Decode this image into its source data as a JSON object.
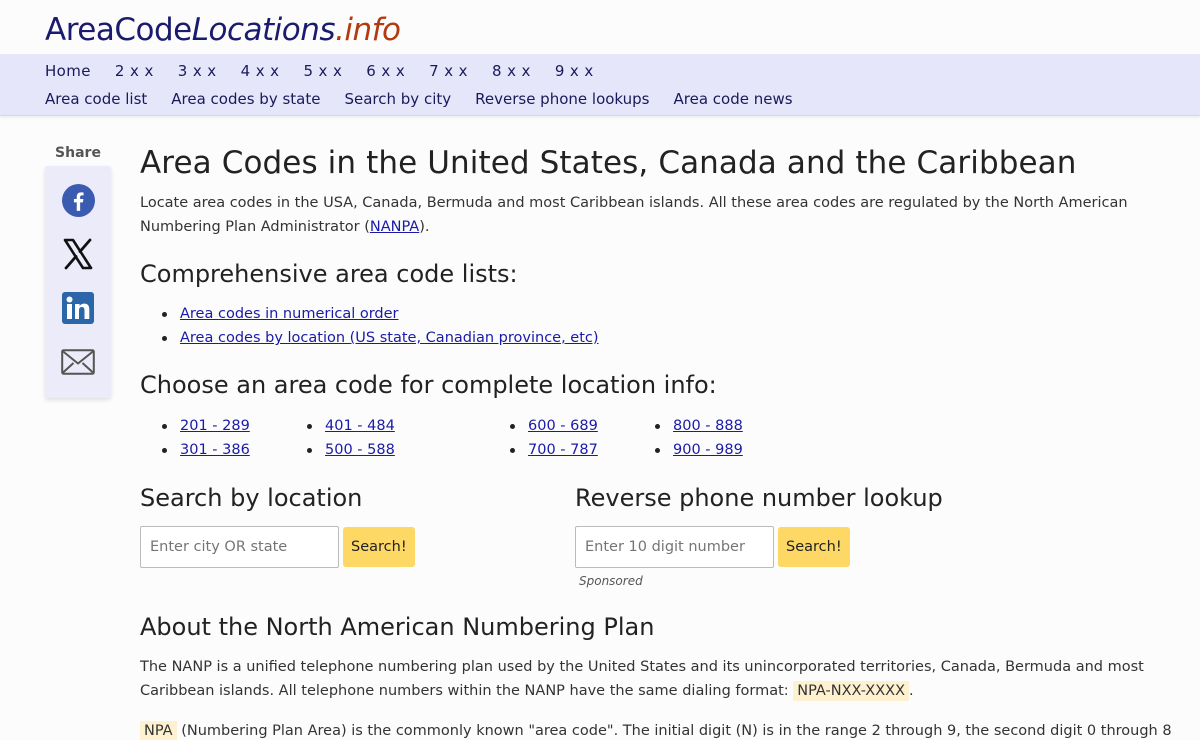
{
  "logo": {
    "part1": "AreaCode",
    "part2": "Locations",
    "part3": ".info"
  },
  "nav": {
    "row1": [
      "Home",
      "2 x x",
      "3 x x",
      "4 x x",
      "5 x x",
      "6 x x",
      "7 x x",
      "8 x x",
      "9 x x"
    ],
    "row2": [
      "Area code list",
      "Area codes by state",
      "Search by city",
      "Reverse phone lookups",
      "Area code news"
    ]
  },
  "share": {
    "label": "Share",
    "icons": [
      "facebook-icon",
      "x-icon",
      "linkedin-icon",
      "email-icon"
    ]
  },
  "main": {
    "title": "Area Codes in the United States, Canada and the Caribbean",
    "intro_before": "Locate area codes in the USA, Canada, Bermuda and most Caribbean islands. All these area codes are regulated by the North American Numbering Plan Administrator (",
    "intro_link": "NANPA",
    "intro_after": ").",
    "lists_heading": "Comprehensive area code lists:",
    "lists": [
      "Area codes in numerical order",
      "Area codes by location (US state, Canadian province, etc)"
    ],
    "choose_heading": "Choose an area code for complete location info:",
    "ranges": [
      [
        "201 - 289",
        "301 - 386"
      ],
      [
        "401 - 484",
        "500 - 588"
      ],
      [
        "600 - 689",
        "700 - 787"
      ],
      [
        "800 - 888",
        "900 - 989"
      ]
    ],
    "search_location": {
      "heading": "Search by location",
      "placeholder": "Enter city OR state",
      "button": "Search!"
    },
    "reverse_lookup": {
      "heading": "Reverse phone number lookup",
      "placeholder": "Enter 10 digit number",
      "button": "Search!",
      "sponsored": "Sponsored"
    },
    "about_heading": "About the North American Numbering Plan",
    "about_p1": "The NANP is a unified telephone numbering plan used by the United States and its unincorporated territories, Canada, Bermuda and most Caribbean islands. All telephone numbers within the NANP have the same dialing format:",
    "about_p1_code": "NPA-NXX-XXXX",
    "about_p1_end": ".",
    "about_p2_code": "NPA",
    "about_p2": "(Numbering Plan Area) is the commonly known \"area code\". The initial digit (N) is in the range 2 through 9, the second digit 0 through 8"
  },
  "colors": {
    "nav_bg": "#e6e6fb",
    "button_bg": "#fdd865",
    "link": "#1a1aa8",
    "logo_accent": "#b33a0e"
  }
}
